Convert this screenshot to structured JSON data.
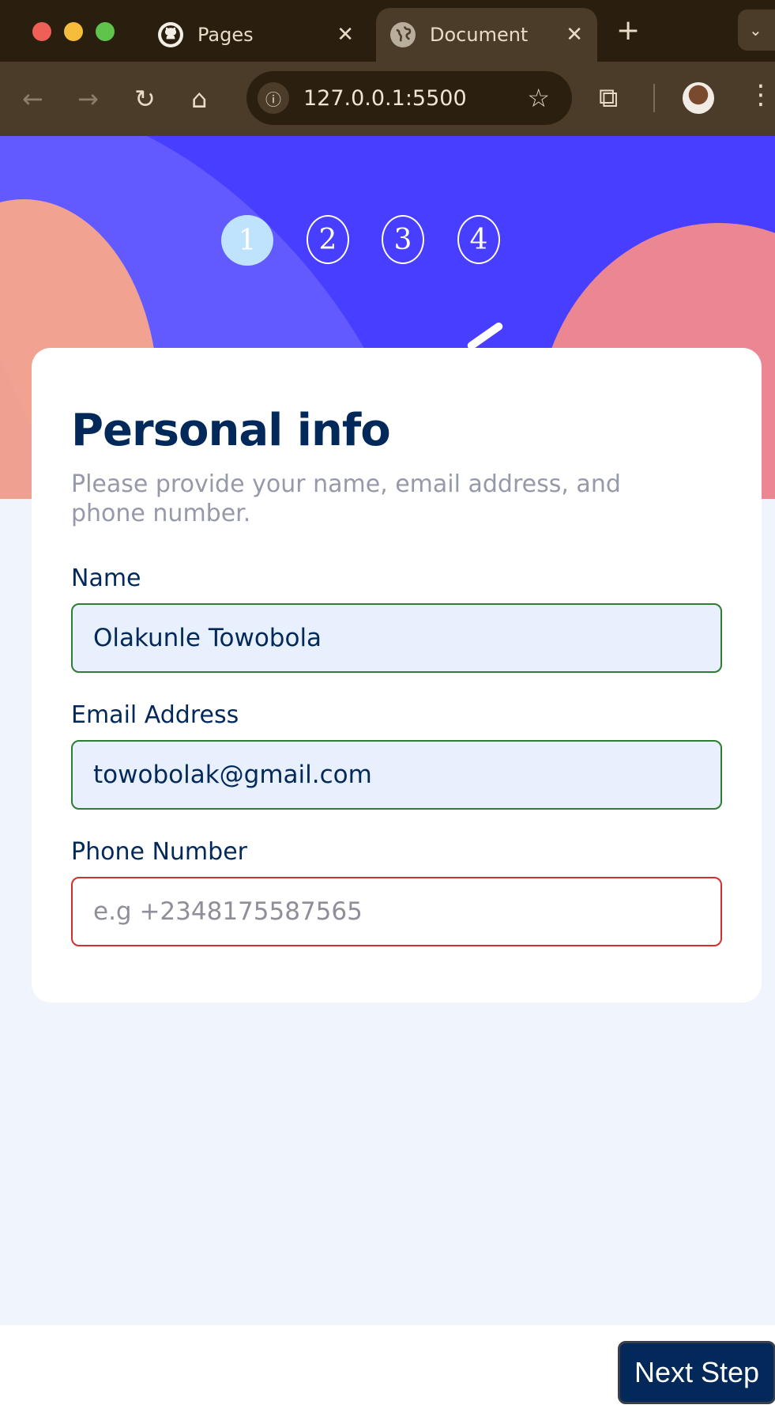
{
  "browser": {
    "tabs": [
      {
        "title": "Pages",
        "icon": "github-icon",
        "active": false
      },
      {
        "title": "Document",
        "icon": "globe-icon",
        "active": true
      }
    ],
    "new_tab": "+",
    "url": "127.0.0.1:5500"
  },
  "steps": [
    "1",
    "2",
    "3",
    "4"
  ],
  "active_step": 1,
  "form": {
    "title": "Personal info",
    "subtitle": "Please provide your name, email address, and phone number.",
    "name": {
      "label": "Name",
      "value": "Olakunle Towobola"
    },
    "email": {
      "label": "Email Address",
      "value": "towobolak@gmail.com"
    },
    "phone": {
      "label": "Phone Number",
      "value": "",
      "placeholder": "e.g +2348175587565"
    }
  },
  "actions": {
    "next_label": "Next Step"
  },
  "colors": {
    "primary": "#022959",
    "accent": "#483eff",
    "valid_border": "#2e7d32",
    "invalid_border": "#d32f2f",
    "page_bg": "#eff4fd"
  }
}
